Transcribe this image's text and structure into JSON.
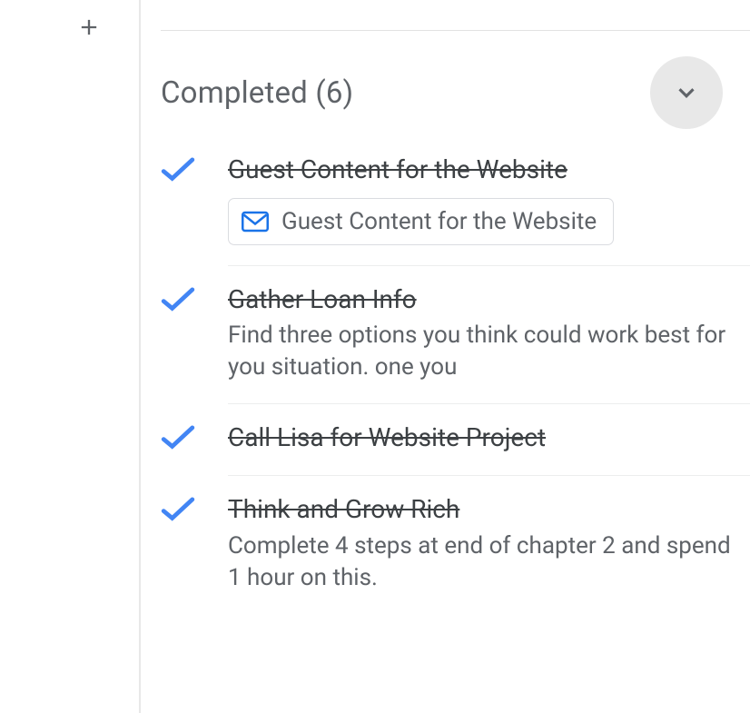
{
  "header": {
    "title": "Completed (6)"
  },
  "tasks": [
    {
      "title": "Guest Content for the Website",
      "chip": "Guest Content for the Website"
    },
    {
      "title": "Gather Loan Info",
      "desc": "Find three options you think could work best for you situation. one you"
    },
    {
      "title": "Call Lisa for Website Project"
    },
    {
      "title": "Think and Grow Rich",
      "desc": "Complete 4 steps at end of chapter 2 and spend 1 hour on this."
    }
  ]
}
